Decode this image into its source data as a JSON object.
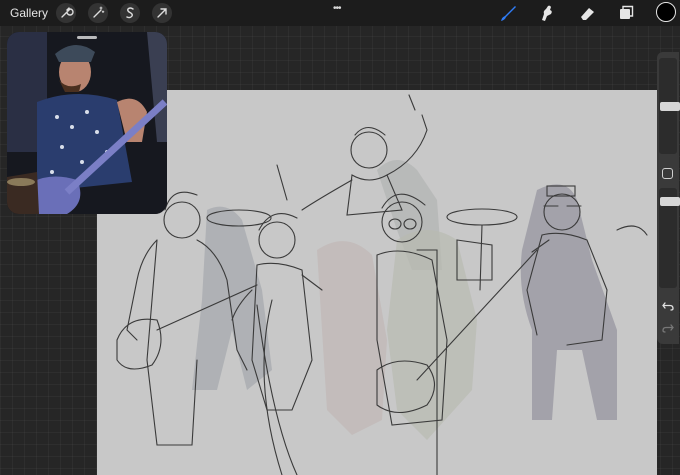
{
  "toolbar": {
    "gallery_label": "Gallery",
    "left_icons": [
      "wrench-icon",
      "magic-wand-icon",
      "selection-s-icon",
      "transform-arrow-icon"
    ],
    "more_glyph": "•••",
    "right_icons": [
      "brush-icon",
      "smudge-icon",
      "eraser-icon",
      "layers-icon"
    ],
    "active_tool": "brush",
    "accent_color": "#2f7cf6",
    "current_color": "#000000"
  },
  "reference_video": {
    "description_icon": "video-reference-icon"
  },
  "sidebar": {
    "brush_size": 0.5,
    "brush_opacity": 0.1,
    "icons": [
      "modify-square-icon",
      "undo-icon",
      "redo-icon"
    ]
  },
  "canvas": {
    "background_color": "#c8c8c8"
  }
}
